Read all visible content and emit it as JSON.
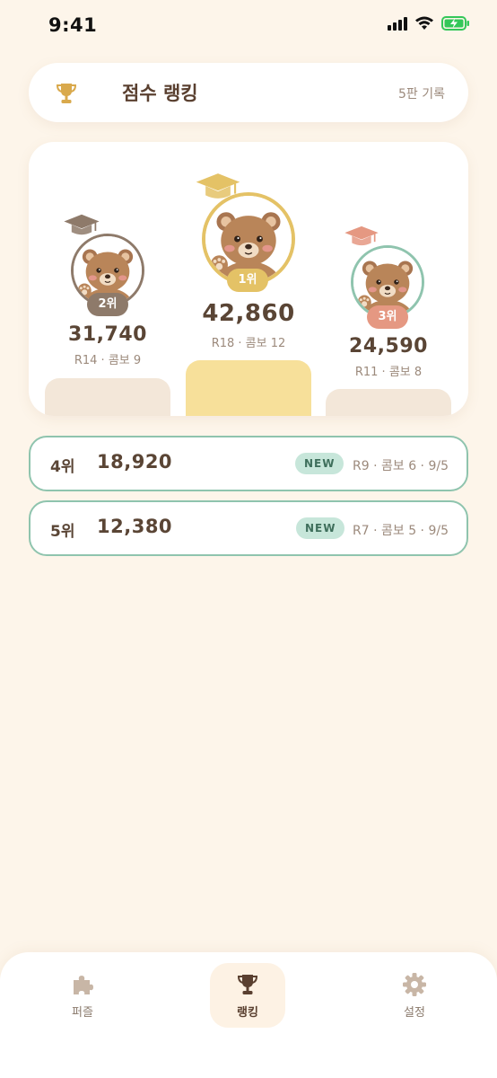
{
  "status_bar": {
    "time": "9:41"
  },
  "header": {
    "title": "점수 랭킹",
    "record_count": "5판 기록"
  },
  "podium": [
    {
      "rank_label": "1위",
      "score": "42,860",
      "meta": "R18 · 콤보 12",
      "accent": "#e4c266"
    },
    {
      "rank_label": "2위",
      "score": "31,740",
      "meta": "R14 · 콤보 9",
      "accent": "#8e7a6a"
    },
    {
      "rank_label": "3위",
      "score": "24,590",
      "meta": "R11 · 콤보 8",
      "accent": "#e59882"
    }
  ],
  "rankings": [
    {
      "rank": "4위",
      "score": "18,920",
      "badge": "NEW",
      "meta": "R9 · 콤보 6 · 9/5"
    },
    {
      "rank": "5위",
      "score": "12,380",
      "badge": "NEW",
      "meta": "R7 · 콤보 5 · 9/5"
    }
  ],
  "tabs": [
    {
      "label": "퍼즐",
      "icon": "puzzle-icon",
      "active": false
    },
    {
      "label": "랭킹",
      "icon": "trophy-icon",
      "active": true
    },
    {
      "label": "설정",
      "icon": "gear-icon",
      "active": false
    }
  ],
  "colors": {
    "background": "#fdf5ea",
    "gold": "#e4c266",
    "silver": "#8e7a6a",
    "bronze": "#e59882",
    "mint": "#8fc4ae"
  }
}
